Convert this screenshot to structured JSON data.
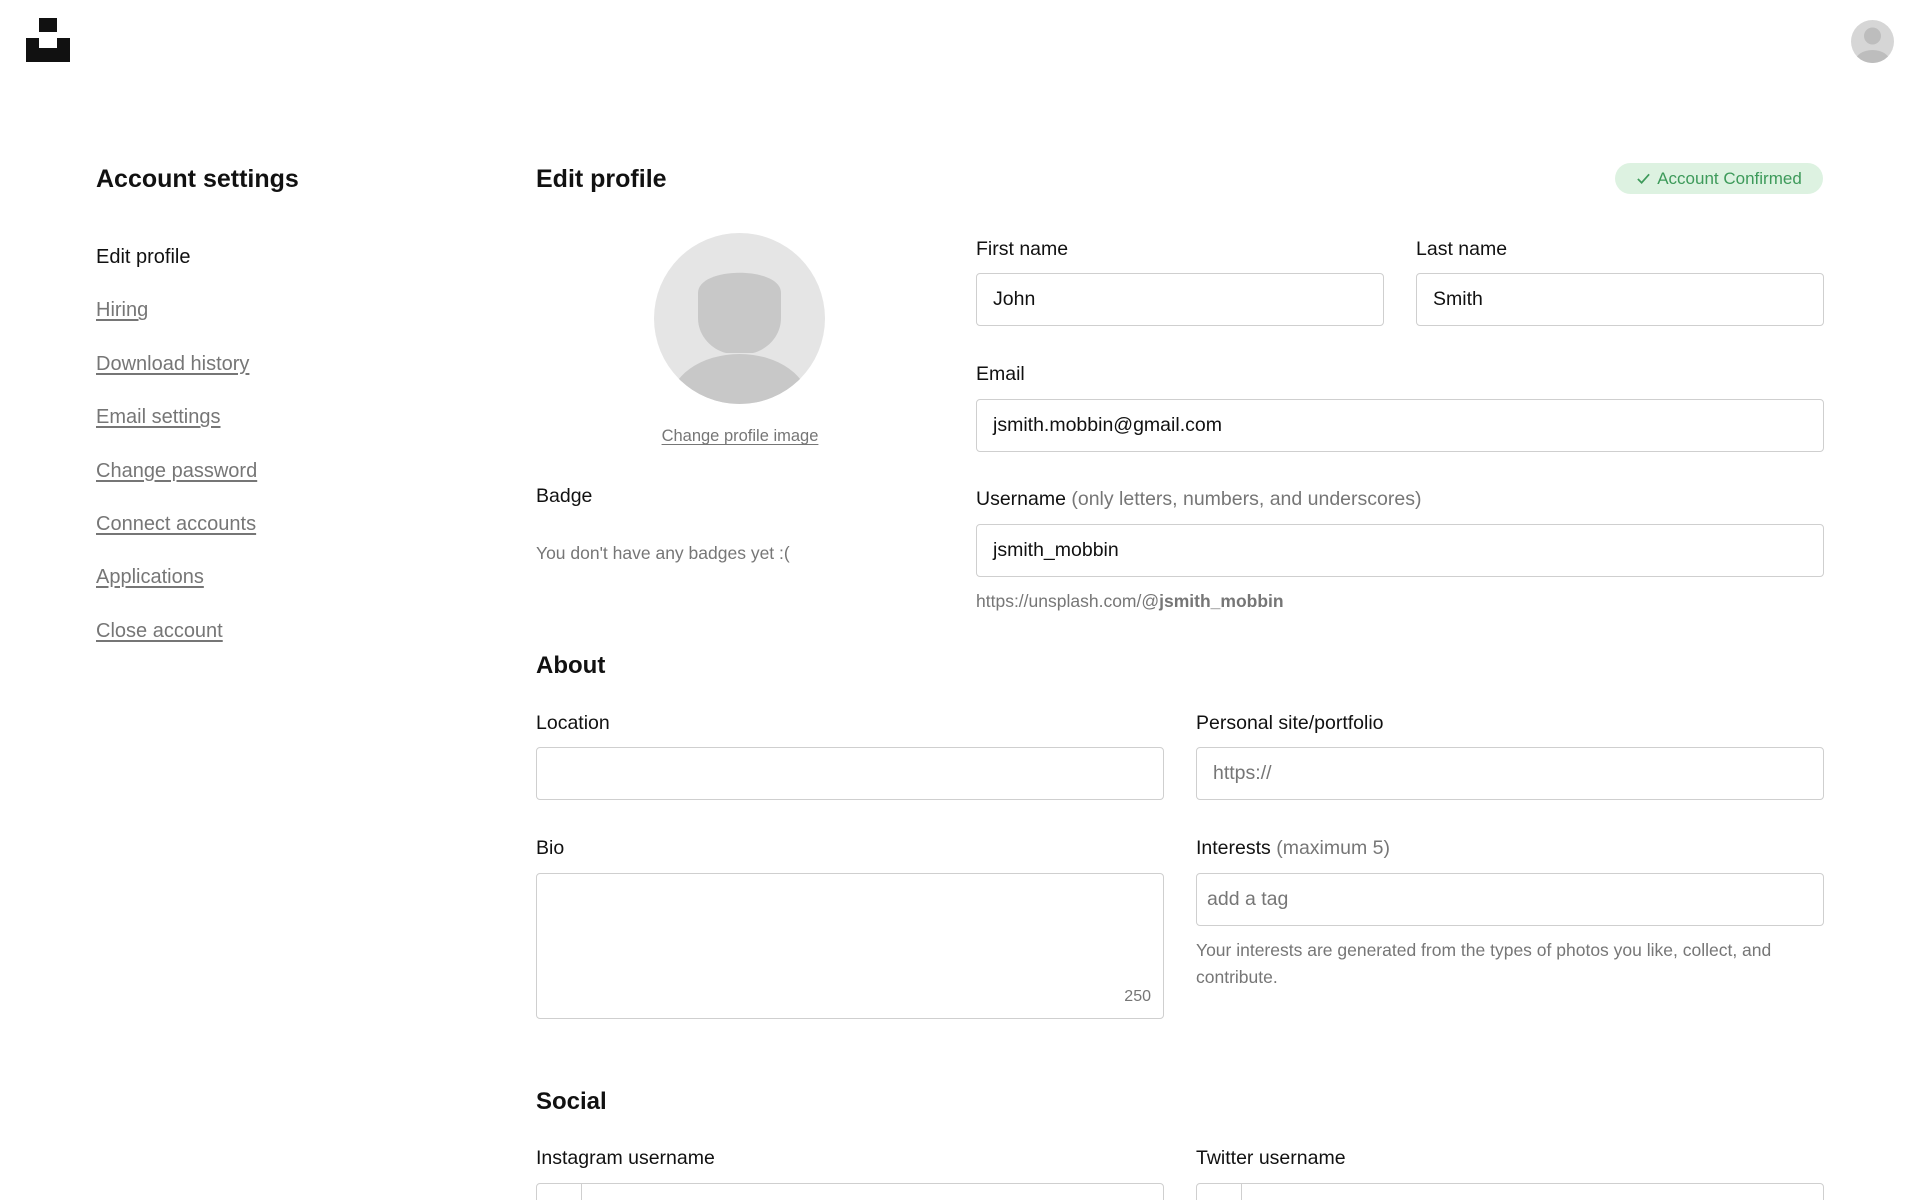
{
  "header": {
    "logo_icon": "unsplash-logo-icon",
    "avatar_icon": "user-avatar-icon"
  },
  "sidebar": {
    "title": "Account settings",
    "items": [
      {
        "label": "Edit profile",
        "active": true
      },
      {
        "label": "Hiring"
      },
      {
        "label": "Download history"
      },
      {
        "label": "Email settings"
      },
      {
        "label": "Change password"
      },
      {
        "label": "Connect accounts"
      },
      {
        "label": "Applications"
      },
      {
        "label": "Close account"
      }
    ]
  },
  "main": {
    "title": "Edit profile",
    "status_badge": "Account Confirmed",
    "status_color": "#3d9a5a",
    "change_image_label": "Change profile image",
    "badge": {
      "label": "Badge",
      "empty_text": "You don't have any badges yet :("
    },
    "first_name": {
      "label": "First name",
      "value": "John"
    },
    "last_name": {
      "label": "Last name",
      "value": "Smith"
    },
    "email": {
      "label": "Email",
      "value": "jsmith.mobbin@gmail.com"
    },
    "username": {
      "label": "Username",
      "hint": "(only letters, numbers, and underscores)",
      "value": "jsmith_mobbin",
      "url_prefix": "https://unsplash.com/@",
      "url_user": "jsmith_mobbin"
    }
  },
  "about": {
    "title": "About",
    "location": {
      "label": "Location",
      "value": ""
    },
    "site": {
      "label": "Personal site/portfolio",
      "placeholder": "https://"
    },
    "bio": {
      "label": "Bio",
      "value": "",
      "counter": "250"
    },
    "interests": {
      "label": "Interests",
      "hint": "(maximum 5)",
      "placeholder": "add a tag",
      "note": "Your interests are generated from the types of photos you like, collect, and contribute."
    }
  },
  "social": {
    "title": "Social",
    "instagram": {
      "label": "Instagram username"
    },
    "twitter": {
      "label": "Twitter username"
    }
  }
}
